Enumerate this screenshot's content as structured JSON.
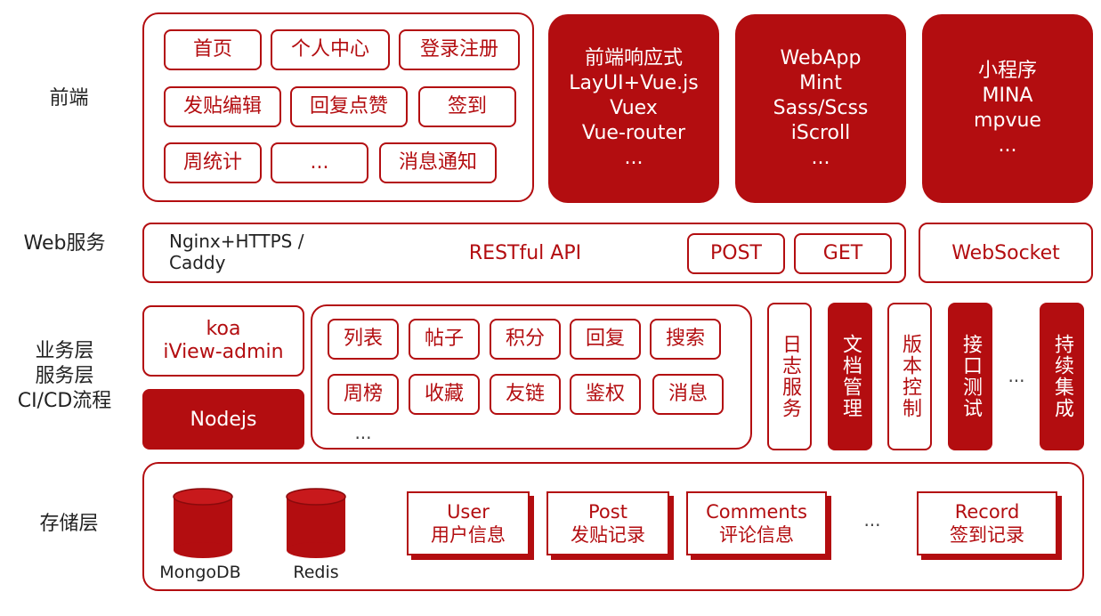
{
  "rows": {
    "frontend_label": "前端",
    "web_label": "Web服务",
    "business_label": [
      "业务层",
      "服务层",
      "CI/CD流程"
    ],
    "storage_label": "存储层"
  },
  "frontend": {
    "pages": [
      "首页",
      "个人中心",
      "登录注册",
      "发贴编辑",
      "回复点赞",
      "签到",
      "周统计",
      "...",
      "消息通知"
    ],
    "stack_web": [
      "前端响应式",
      "LayUI+Vue.js",
      "Vuex",
      "Vue-router",
      "..."
    ],
    "stack_webapp": [
      "WebApp",
      "Mint",
      "Sass/Scss",
      "iScroll",
      "..."
    ],
    "stack_mini": [
      "小程序",
      "MINA",
      "mpvue",
      "..."
    ]
  },
  "web": {
    "server": "Nginx+HTTPS / Caddy",
    "api": "RESTful API",
    "post": "POST",
    "get": "GET",
    "websocket": "WebSocket"
  },
  "business": {
    "koa": [
      "koa",
      "iView-admin"
    ],
    "nodejs": "Nodejs",
    "modules": [
      "列表",
      "帖子",
      "积分",
      "回复",
      "搜索",
      "周榜",
      "收藏",
      "友链",
      "鉴权",
      "消息"
    ],
    "modules_more": "...",
    "ci": [
      "日志服务",
      "文档管理",
      "版本控制",
      "接口测试",
      "...",
      "持续集成"
    ]
  },
  "storage": {
    "dbs": [
      "MongoDB",
      "Redis"
    ],
    "tables": [
      {
        "en": "User",
        "zh": "用户信息"
      },
      {
        "en": "Post",
        "zh": "发贴记录"
      },
      {
        "en": "Comments",
        "zh": "评论信息"
      },
      {
        "en": "Record",
        "zh": "签到记录"
      }
    ],
    "more": "..."
  },
  "colors": {
    "accent": "#b30d10"
  }
}
